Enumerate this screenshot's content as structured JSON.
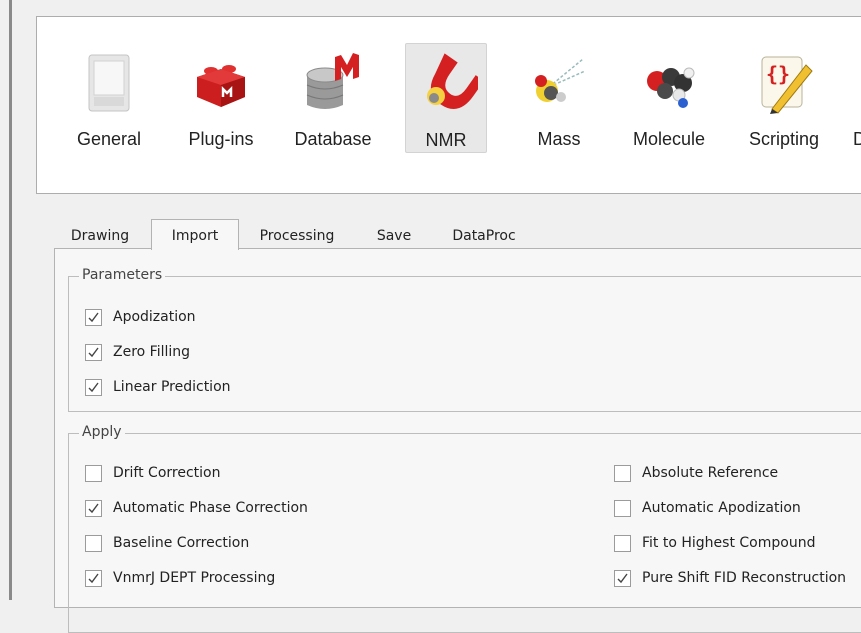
{
  "toolbar": {
    "items": [
      {
        "label": "General",
        "icon": "general-icon",
        "selected": false
      },
      {
        "label": "Plug-ins",
        "icon": "plugins-icon",
        "selected": false
      },
      {
        "label": "Database",
        "icon": "database-icon",
        "selected": false
      },
      {
        "label": "NMR",
        "icon": "nmr-magnet-icon",
        "selected": true
      },
      {
        "label": "Mass",
        "icon": "mass-icon",
        "selected": false
      },
      {
        "label": "Molecule",
        "icon": "molecule-icon",
        "selected": false
      },
      {
        "label": "Scripting",
        "icon": "scripting-icon",
        "selected": false
      },
      {
        "label": "D",
        "icon": "partial-icon",
        "selected": false
      }
    ]
  },
  "tabs": [
    {
      "label": "Drawing",
      "active": false
    },
    {
      "label": "Import",
      "active": true
    },
    {
      "label": "Processing",
      "active": false
    },
    {
      "label": "Save",
      "active": false
    },
    {
      "label": "DataProc",
      "active": false
    }
  ],
  "parameters": {
    "title": "Parameters",
    "options": [
      {
        "label": "Apodization",
        "checked": true
      },
      {
        "label": "Zero Filling",
        "checked": true
      },
      {
        "label": "Linear Prediction",
        "checked": true
      }
    ]
  },
  "apply": {
    "title": "Apply",
    "left": [
      {
        "label": "Drift Correction",
        "checked": false
      },
      {
        "label": "Automatic Phase Correction",
        "checked": true
      },
      {
        "label": "Baseline Correction",
        "checked": false
      },
      {
        "label": "VnmrJ DEPT Processing",
        "checked": true
      }
    ],
    "right": [
      {
        "label": "Absolute Reference",
        "checked": false
      },
      {
        "label": "Automatic Apodization",
        "checked": false
      },
      {
        "label": "Fit to Highest Compound",
        "checked": false
      },
      {
        "label": "Pure Shift FID Reconstruction",
        "checked": true
      }
    ]
  },
  "colors": {
    "accent_red": "#d42020",
    "selected_bg": "#e8e8e8",
    "panel_bg": "#f7f7f7"
  }
}
